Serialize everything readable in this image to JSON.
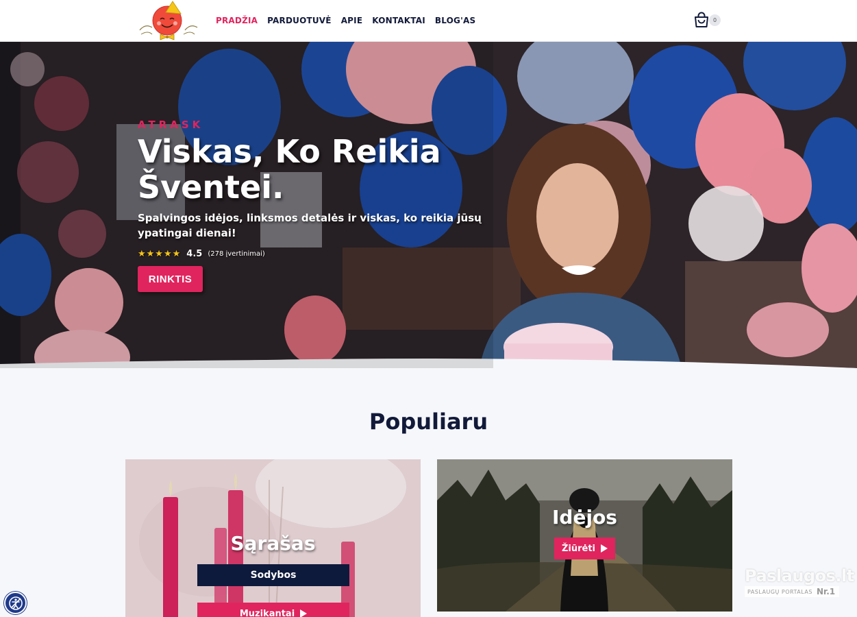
{
  "brand": {
    "logo_icon": "party-mascot-logo"
  },
  "nav": {
    "items": [
      {
        "label": "PRADŽIA",
        "active": true
      },
      {
        "label": "PARDUOTUVĖ",
        "active": false
      },
      {
        "label": "APIE",
        "active": false
      },
      {
        "label": "KONTAKTAI",
        "active": false
      },
      {
        "label": "BLOG'AS",
        "active": false
      }
    ]
  },
  "cart": {
    "icon": "shopping-bag-icon",
    "count": "0"
  },
  "hero": {
    "eyebrow": "ATRASK",
    "title": "Viskas, Ko Reikia Šventei.",
    "subtitle": "Spalvingos idėjos, linksmos detalės ir viskas, ko reikia jūsų ypatingai dienai!",
    "stars": "★★★★★",
    "rating_value": "4.5",
    "rating_count": "(278 įvertinimai)",
    "button": "RINKTIS"
  },
  "popular": {
    "title": "Populiaru",
    "cards": [
      {
        "title": "Sąrašas",
        "item_primary": "Sodybos",
        "item_secondary": "Muzikantai"
      },
      {
        "title": "Idėjos",
        "button": "Žiūrėti"
      }
    ]
  },
  "accessibility": {
    "icon": "accessibility-icon"
  },
  "watermark": {
    "brand": "Paslaugos.lt",
    "tagline": "PASLAUGŲ PORTALAS",
    "badge": "Nr.1"
  },
  "colors": {
    "accent": "#e0245e",
    "navy": "#0e1a3c",
    "text": "#121a3a",
    "star": "#f5c518",
    "a11y": "#1f3a8a"
  }
}
